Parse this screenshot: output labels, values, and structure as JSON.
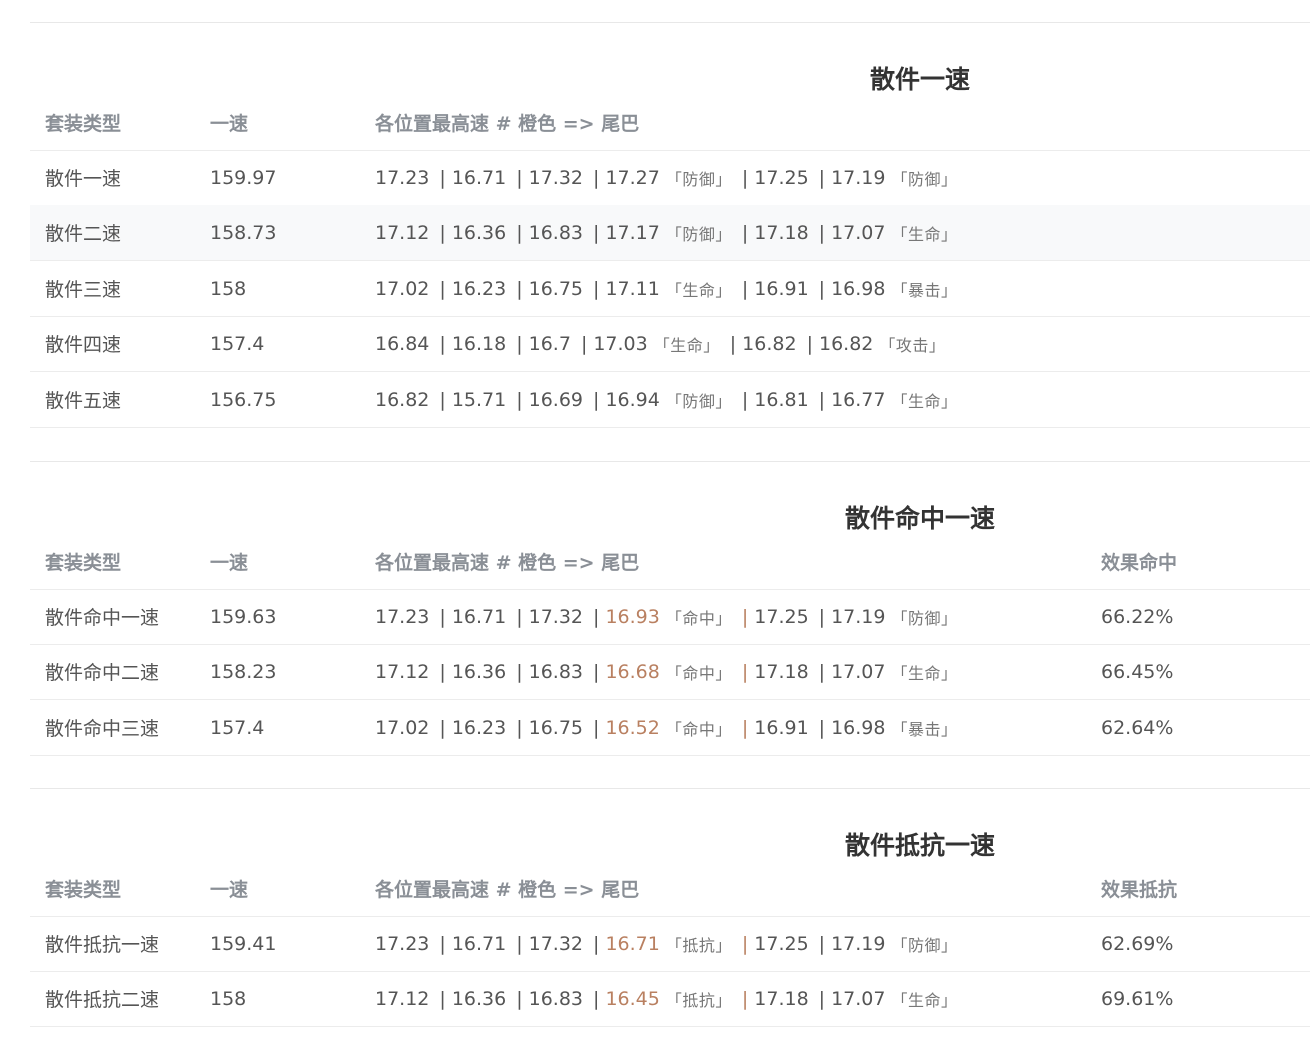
{
  "sections": [
    {
      "title": "散件一速",
      "headers": [
        "套装类型",
        "一速",
        "各位置最高速 # 橙色 => 尾巴"
      ],
      "rows": [
        {
          "name": "散件一速",
          "speed": "159.97",
          "vals": [
            "17.23",
            "16.71",
            "17.32",
            "17.27",
            "17.25",
            "17.19"
          ],
          "tag4": "「防御」",
          "tag6": "「防御」"
        },
        {
          "name": "散件二速",
          "speed": "158.73",
          "vals": [
            "17.12",
            "16.36",
            "16.83",
            "17.17",
            "17.18",
            "17.07"
          ],
          "tag4": "「防御」",
          "tag6": "「生命」"
        },
        {
          "name": "散件三速",
          "speed": "158",
          "vals": [
            "17.02",
            "16.23",
            "16.75",
            "17.11",
            "16.91",
            "16.98"
          ],
          "tag4": "「生命」",
          "tag6": "「暴击」"
        },
        {
          "name": "散件四速",
          "speed": "157.4",
          "vals": [
            "16.84",
            "16.18",
            "16.7",
            "17.03",
            "16.82",
            "16.82"
          ],
          "tag4": "「生命」",
          "tag6": "「攻击」"
        },
        {
          "name": "散件五速",
          "speed": "156.75",
          "vals": [
            "16.82",
            "15.71",
            "16.69",
            "16.94",
            "16.81",
            "16.77"
          ],
          "tag4": "「防御」",
          "tag6": "「生命」"
        }
      ]
    },
    {
      "title": "散件命中一速",
      "headers": [
        "套装类型",
        "一速",
        "各位置最高速 # 橙色 => 尾巴",
        "效果命中"
      ],
      "rows": [
        {
          "name": "散件命中一速",
          "speed": "159.63",
          "vals": [
            "17.23",
            "16.71",
            "17.32",
            "16.93",
            "17.25",
            "17.19"
          ],
          "tag4": "「命中」",
          "tag6": "「防御」",
          "extra": "66.22%"
        },
        {
          "name": "散件命中二速",
          "speed": "158.23",
          "vals": [
            "17.12",
            "16.36",
            "16.83",
            "16.68",
            "17.18",
            "17.07"
          ],
          "tag4": "「命中」",
          "tag6": "「生命」",
          "extra": "66.45%"
        },
        {
          "name": "散件命中三速",
          "speed": "157.4",
          "vals": [
            "17.02",
            "16.23",
            "16.75",
            "16.52",
            "16.91",
            "16.98"
          ],
          "tag4": "「命中」",
          "tag6": "「暴击」",
          "extra": "62.64%"
        }
      ]
    },
    {
      "title": "散件抵抗一速",
      "headers": [
        "套装类型",
        "一速",
        "各位置最高速 # 橙色 => 尾巴",
        "效果抵抗"
      ],
      "rows": [
        {
          "name": "散件抵抗一速",
          "speed": "159.41",
          "vals": [
            "17.23",
            "16.71",
            "17.32",
            "16.71",
            "17.25",
            "17.19"
          ],
          "tag4": "「抵抗」",
          "tag6": "「防御」",
          "extra": "62.69%"
        },
        {
          "name": "散件抵抗二速",
          "speed": "158",
          "vals": [
            "17.12",
            "16.36",
            "16.83",
            "16.45",
            "17.18",
            "17.07"
          ],
          "tag4": "「抵抗」",
          "tag6": "「生命」",
          "extra": "69.61%"
        }
      ]
    }
  ],
  "colors": {
    "highlight": "#b98061",
    "alt_row": "#f8f9fa"
  }
}
